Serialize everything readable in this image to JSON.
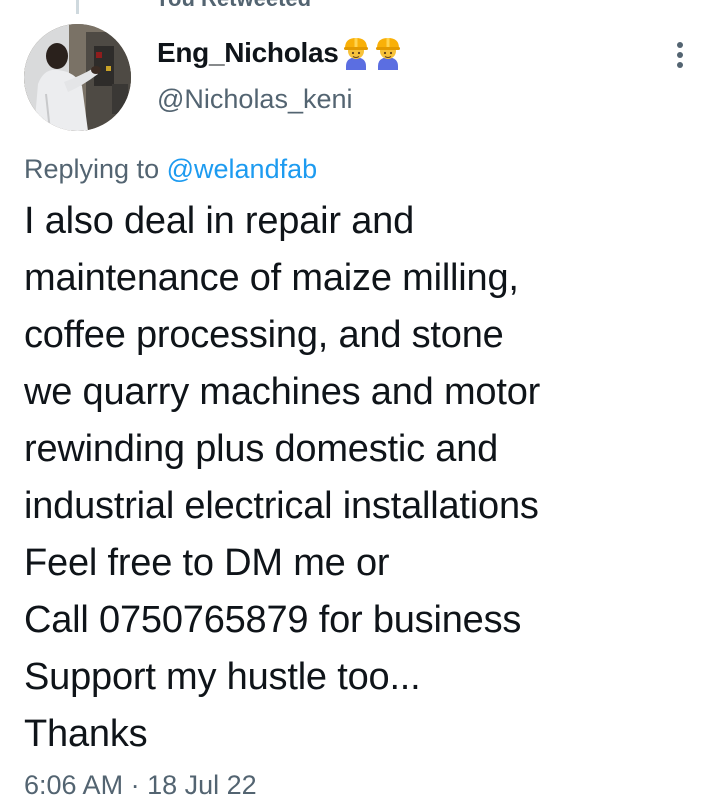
{
  "header": {
    "retweet_context": "You Retweeted"
  },
  "author": {
    "display_name": "Eng_Nicholas",
    "badge_icons": [
      "construction-worker-emoji",
      "construction-worker-emoji"
    ],
    "handle": "@Nicholas_keni"
  },
  "reply": {
    "prefix": "Replying to",
    "mention": "@welandfab"
  },
  "tweet": {
    "lines": [
      "I also deal in repair and",
      "maintenance of maize milling,",
      "coffee processing, and stone",
      "we quarry machines and motor",
      "rewinding plus domestic and",
      "industrial electrical installations",
      "Feel free to DM me or",
      "Call 0750765879 for business",
      "Support my hustle too...",
      "Thanks"
    ]
  },
  "meta": {
    "time": "6:06 AM",
    "separator": "·",
    "date": "18 Jul 22"
  },
  "colors": {
    "text_primary": "#0f1419",
    "text_secondary": "#536471",
    "link": "#1d9bf0"
  }
}
